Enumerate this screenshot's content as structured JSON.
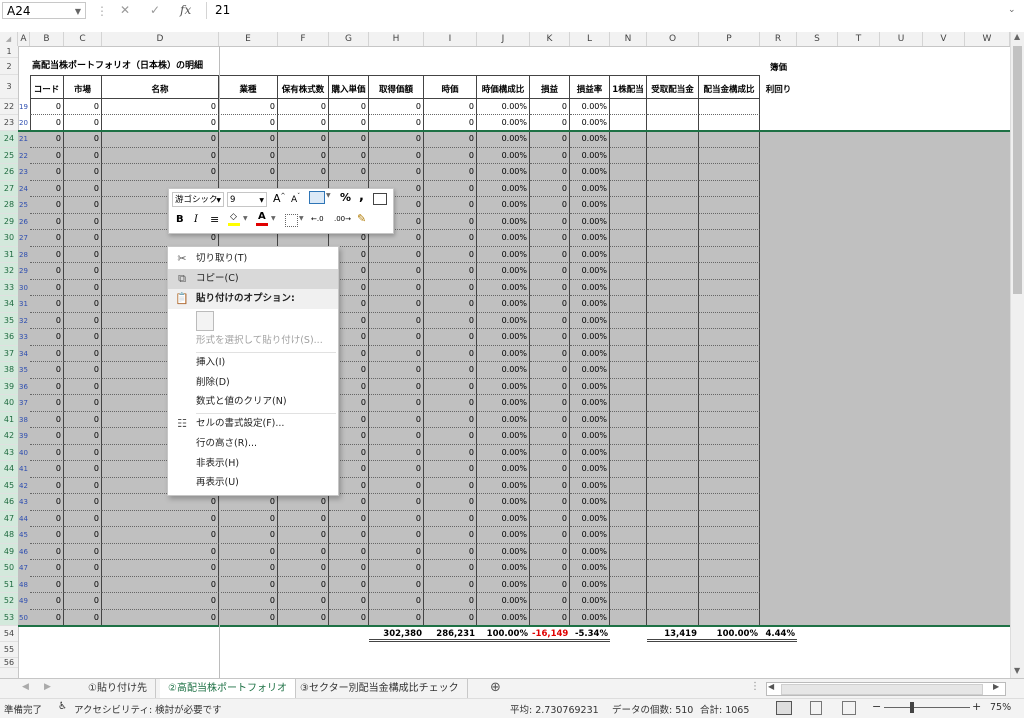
{
  "formula_bar": {
    "name_box": "A24",
    "fx_label": "fx",
    "value": "21"
  },
  "columns": [
    "A",
    "B",
    "C",
    "D",
    "E",
    "F",
    "G",
    "H",
    "I",
    "J",
    "K",
    "L",
    "N",
    "O",
    "P",
    "R",
    "S",
    "T",
    "U",
    "V",
    "W"
  ],
  "sheet_title": "高配当株ポートフォリオ（日本株）の明細",
  "table_headers": [
    "コード",
    "市場",
    "名称",
    "業種",
    "保有株式数",
    "購入単価",
    "取得価額",
    "時価",
    "時価構成比",
    "損益",
    "損益率",
    "1株配当",
    "受取配当金",
    "配当金構成比",
    "簿価",
    "利回り"
  ],
  "row_numbers": [
    "1",
    "2",
    "3",
    "22",
    "23",
    "24",
    "25",
    "26",
    "27",
    "28",
    "29",
    "30",
    "31",
    "32",
    "33",
    "34",
    "35",
    "36",
    "37",
    "38",
    "39",
    "40",
    "41",
    "42",
    "43",
    "44",
    "45",
    "46",
    "47",
    "48",
    "49",
    "50",
    "51",
    "52",
    "53",
    "54",
    "55",
    "56"
  ],
  "data_rows": [
    {
      "no": "19",
      "v": [
        "0",
        "0",
        "0",
        "0",
        "0",
        "0",
        "0",
        "0",
        "0.00%",
        "0",
        "0.00%"
      ]
    },
    {
      "no": "20",
      "v": [
        "0",
        "0",
        "0",
        "0",
        "0",
        "0",
        "0",
        "0",
        "0.00%",
        "0",
        "0.00%"
      ]
    },
    {
      "no": "21",
      "v": [
        "0",
        "0",
        "0",
        "0",
        "0",
        "0",
        "0",
        "0",
        "0.00%",
        "0",
        "0.00%"
      ]
    },
    {
      "no": "22",
      "v": [
        "0",
        "0",
        "0",
        "0",
        "0",
        "0",
        "0",
        "0",
        "0.00%",
        "0",
        "0.00%"
      ]
    },
    {
      "no": "23",
      "v": [
        "0",
        "0",
        "0",
        "0",
        "0",
        "0",
        "0",
        "0",
        "0.00%",
        "0",
        "0.00%"
      ]
    },
    {
      "no": "24",
      "v": [
        "0",
        "0",
        "",
        "",
        "",
        "",
        "0",
        "0",
        "0.00%",
        "0",
        "0.00%"
      ]
    },
    {
      "no": "25",
      "v": [
        "0",
        "0",
        "",
        "",
        "",
        "",
        "0",
        "0",
        "0.00%",
        "0",
        "0.00%"
      ]
    },
    {
      "no": "26",
      "v": [
        "0",
        "0",
        "",
        "",
        "",
        "",
        "0",
        "0",
        "0.00%",
        "0",
        "0.00%"
      ]
    },
    {
      "no": "27",
      "v": [
        "0",
        "0",
        "0",
        "",
        "",
        "0",
        "0",
        "0",
        "0.00%",
        "0",
        "0.00%"
      ]
    },
    {
      "no": "28",
      "v": [
        "0",
        "0",
        "",
        "",
        "",
        "0",
        "0",
        "0",
        "0.00%",
        "0",
        "0.00%"
      ]
    },
    {
      "no": "29",
      "v": [
        "0",
        "0",
        "",
        "",
        "",
        "0",
        "0",
        "0",
        "0.00%",
        "0",
        "0.00%"
      ]
    },
    {
      "no": "30",
      "v": [
        "0",
        "0",
        "",
        "",
        "",
        "0",
        "0",
        "0",
        "0.00%",
        "0",
        "0.00%"
      ]
    },
    {
      "no": "31",
      "v": [
        "0",
        "0",
        "",
        "",
        "",
        "0",
        "0",
        "0",
        "0.00%",
        "0",
        "0.00%"
      ]
    },
    {
      "no": "32",
      "v": [
        "0",
        "0",
        "",
        "",
        "",
        "0",
        "0",
        "0",
        "0.00%",
        "0",
        "0.00%"
      ]
    },
    {
      "no": "33",
      "v": [
        "0",
        "0",
        "",
        "",
        "",
        "0",
        "0",
        "0",
        "0.00%",
        "0",
        "0.00%"
      ]
    },
    {
      "no": "34",
      "v": [
        "0",
        "0",
        "",
        "",
        "",
        "0",
        "0",
        "0",
        "0.00%",
        "0",
        "0.00%"
      ]
    },
    {
      "no": "35",
      "v": [
        "0",
        "0",
        "",
        "",
        "",
        "0",
        "0",
        "0",
        "0.00%",
        "0",
        "0.00%"
      ]
    },
    {
      "no": "36",
      "v": [
        "0",
        "0",
        "",
        "",
        "",
        "0",
        "0",
        "0",
        "0.00%",
        "0",
        "0.00%"
      ]
    },
    {
      "no": "37",
      "v": [
        "0",
        "0",
        "",
        "",
        "",
        "0",
        "0",
        "0",
        "0.00%",
        "0",
        "0.00%"
      ]
    },
    {
      "no": "38",
      "v": [
        "0",
        "0",
        "",
        "",
        "",
        "0",
        "0",
        "0",
        "0.00%",
        "0",
        "0.00%"
      ]
    },
    {
      "no": "39",
      "v": [
        "0",
        "0",
        "",
        "",
        "",
        "0",
        "0",
        "0",
        "0.00%",
        "0",
        "0.00%"
      ]
    },
    {
      "no": "40",
      "v": [
        "0",
        "0",
        "",
        "",
        "",
        "0",
        "0",
        "0",
        "0.00%",
        "0",
        "0.00%"
      ]
    },
    {
      "no": "41",
      "v": [
        "0",
        "0",
        "",
        "",
        "",
        "0",
        "0",
        "0",
        "0.00%",
        "0",
        "0.00%"
      ]
    },
    {
      "no": "42",
      "v": [
        "0",
        "0",
        "",
        "",
        "",
        "0",
        "0",
        "0",
        "0.00%",
        "0",
        "0.00%"
      ]
    },
    {
      "no": "43",
      "v": [
        "0",
        "0",
        "0",
        "0",
        "0",
        "0",
        "0",
        "0",
        "0.00%",
        "0",
        "0.00%"
      ]
    },
    {
      "no": "44",
      "v": [
        "0",
        "0",
        "0",
        "0",
        "0",
        "0",
        "0",
        "0",
        "0.00%",
        "0",
        "0.00%"
      ]
    },
    {
      "no": "45",
      "v": [
        "0",
        "0",
        "0",
        "0",
        "0",
        "0",
        "0",
        "0",
        "0.00%",
        "0",
        "0.00%"
      ]
    },
    {
      "no": "46",
      "v": [
        "0",
        "0",
        "0",
        "0",
        "0",
        "0",
        "0",
        "0",
        "0.00%",
        "0",
        "0.00%"
      ]
    },
    {
      "no": "47",
      "v": [
        "0",
        "0",
        "0",
        "0",
        "0",
        "0",
        "0",
        "0",
        "0.00%",
        "0",
        "0.00%"
      ]
    },
    {
      "no": "48",
      "v": [
        "0",
        "0",
        "0",
        "0",
        "0",
        "0",
        "0",
        "0",
        "0.00%",
        "0",
        "0.00%"
      ]
    },
    {
      "no": "49",
      "v": [
        "0",
        "0",
        "0",
        "0",
        "0",
        "0",
        "0",
        "0",
        "0.00%",
        "0",
        "0.00%"
      ]
    },
    {
      "no": "50",
      "v": [
        "0",
        "0",
        "0",
        "0",
        "0",
        "0",
        "0",
        "0",
        "0.00%",
        "0",
        "0.00%"
      ]
    }
  ],
  "totals": {
    "acq": "302,380",
    "mv": "286,231",
    "ratio": "100.00%",
    "pl": "-16,149",
    "plr": "-5.34%",
    "div": "13,419",
    "divr": "100.00%",
    "yield": "4.44%",
    "pl_color": "#e00000"
  },
  "mini_toolbar": {
    "font": "游ゴシック",
    "size": "9",
    "pct": "%",
    "comma": ",",
    "bold": "B",
    "italic": "I",
    "inc_font": "A",
    "dec_font": "A",
    "dec_inc": "←.0",
    "dec_dec": ".00→"
  },
  "context_menu": {
    "cut": "切り取り(T)",
    "copy": "コピー(C)",
    "paste_opts": "貼り付けのオプション:",
    "paste_special": "形式を選択して貼り付け(S)...",
    "insert": "挿入(I)",
    "delete": "削除(D)",
    "clear": "数式と値のクリア(N)",
    "format": "セルの書式設定(F)...",
    "row_height": "行の高さ(R)...",
    "hide": "非表示(H)",
    "unhide": "再表示(U)"
  },
  "tabs": [
    "①貼り付け先",
    "②高配当株ポートフォリオ",
    "③セクター別配当金構成比チェック"
  ],
  "status": {
    "ready": "準備完了",
    "accessibility": "アクセシビリティ: 検討が必要です",
    "avg": "平均: 2.730769231",
    "count": "データの個数: 510",
    "sum": "合計: 1065",
    "zoom": "75%"
  },
  "colors": {
    "accent": "#1e7145",
    "selected_gray": "#c0c0c0",
    "negative": "#e00000"
  }
}
